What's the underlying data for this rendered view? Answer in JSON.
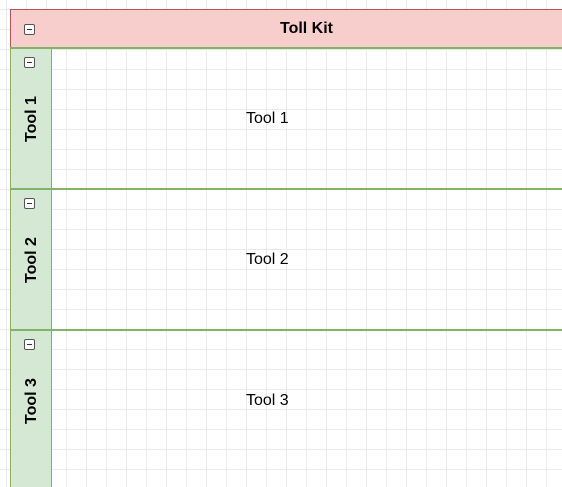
{
  "pool": {
    "title": "Toll Kit",
    "header_color": "#f8cecc",
    "header_stroke": "#b85450"
  },
  "lanes": [
    {
      "label": "Tool 1",
      "content": "Tool 1"
    },
    {
      "label": "Tool 2",
      "content": "Tool 2"
    },
    {
      "label": "Tool 3",
      "content": "Tool 3"
    }
  ],
  "lane_header_color": "#d5e8d4",
  "lane_stroke_color": "#82b366",
  "icons": {
    "collapse": "minus-square-icon"
  }
}
